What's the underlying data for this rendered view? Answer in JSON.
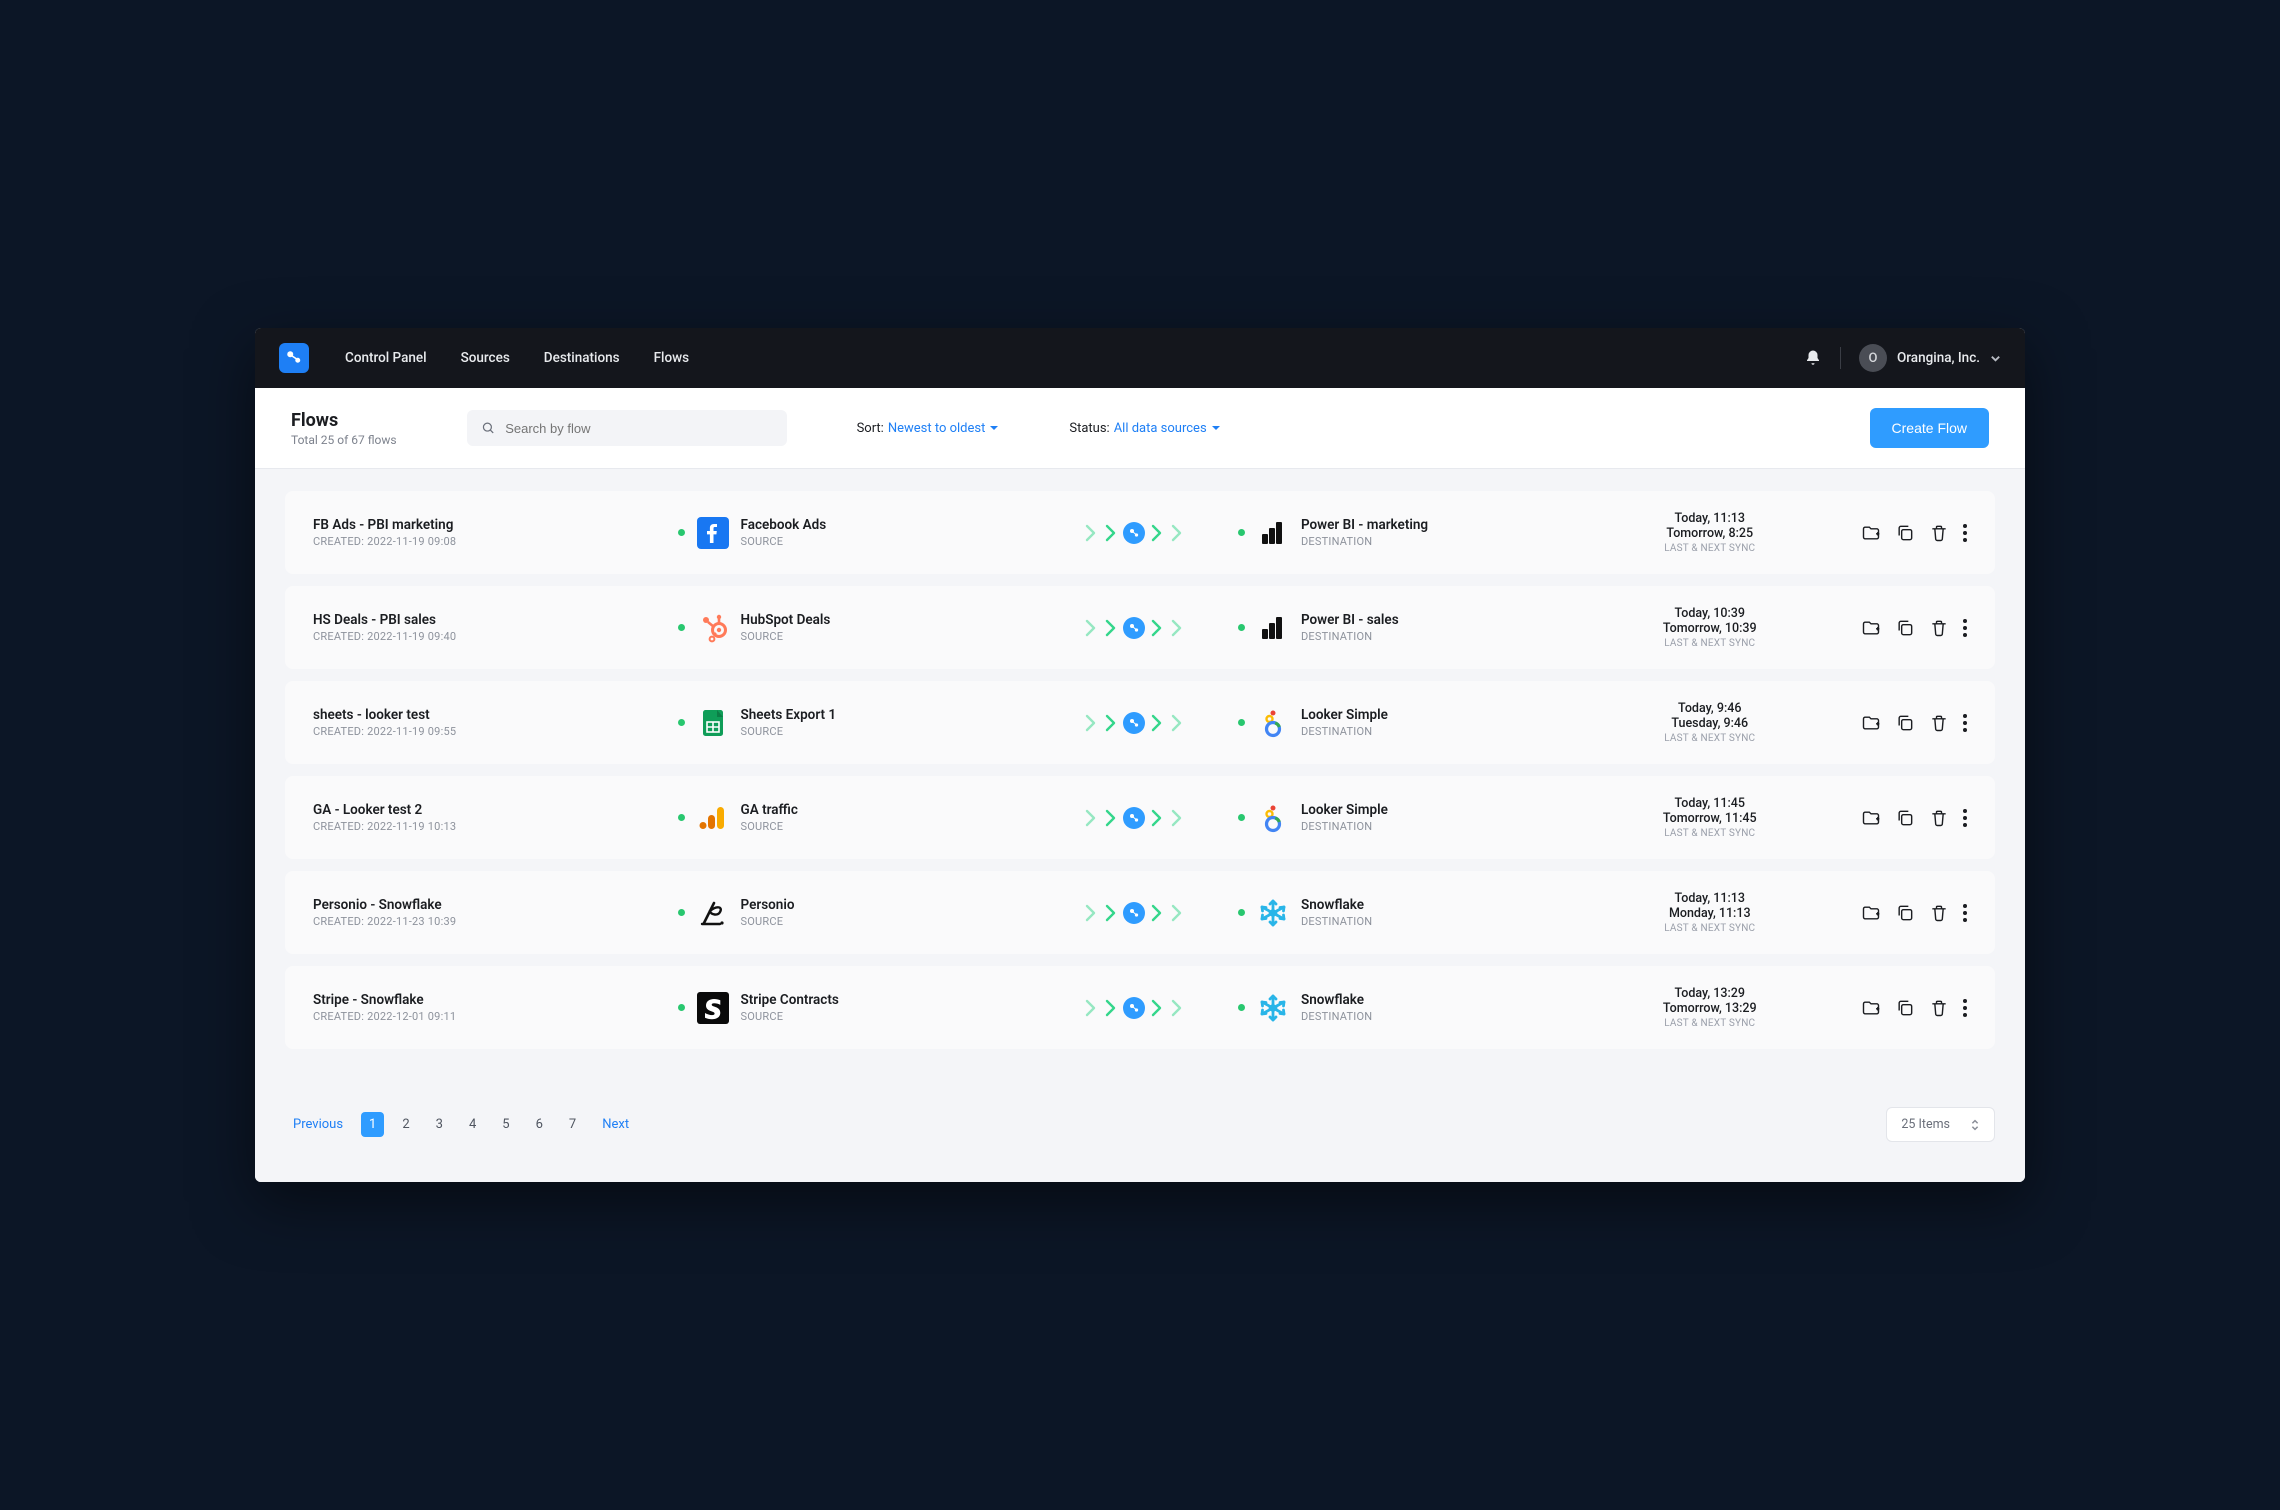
{
  "nav": {
    "items": [
      "Control Panel",
      "Sources",
      "Destinations",
      "Flows"
    ],
    "account_name": "Orangina, Inc.",
    "avatar_letter": "O"
  },
  "header": {
    "title": "Flows",
    "subtitle": "Total 25 of 67 flows",
    "search_placeholder": "Search by flow",
    "sort_label": "Sort:",
    "sort_value": "Newest to oldest",
    "status_label": "Status:",
    "status_value": "All data sources",
    "create_label": "Create Flow"
  },
  "common": {
    "source_label": "SOURCE",
    "destination_label": "DESTINATION",
    "sync_label": "LAST & NEXT SYNC"
  },
  "rows": [
    {
      "name": "FB Ads - PBI marketing",
      "created": "CREATED: 2022-11-19 09:08",
      "source": "Facebook Ads",
      "source_icon": "facebook",
      "destination": "Power BI - marketing",
      "dest_icon": "powerbi",
      "sync1": "Today, 11:13",
      "sync2": "Tomorrow, 8:25"
    },
    {
      "name": "HS Deals - PBI sales",
      "created": "CREATED: 2022-11-19 09:40",
      "source": "HubSpot Deals",
      "source_icon": "hubspot",
      "destination": "Power BI - sales",
      "dest_icon": "powerbi",
      "sync1": "Today, 10:39",
      "sync2": "Tomorrow, 10:39"
    },
    {
      "name": "sheets - looker test",
      "created": "CREATED: 2022-11-19 09:55",
      "source": "Sheets Export 1",
      "source_icon": "sheets",
      "destination": "Looker Simple",
      "dest_icon": "looker",
      "sync1": "Today, 9:46",
      "sync2": "Tuesday, 9:46"
    },
    {
      "name": "GA - Looker test 2",
      "created": "CREATED: 2022-11-19 10:13",
      "source": "GA traffic",
      "source_icon": "ga",
      "destination": "Looker Simple",
      "dest_icon": "looker",
      "sync1": "Today, 11:45",
      "sync2": "Tomorrow, 11:45"
    },
    {
      "name": "Personio - Snowflake",
      "created": "CREATED: 2022-11-23 10:39",
      "source": "Personio",
      "source_icon": "personio",
      "destination": "Snowflake",
      "dest_icon": "snowflake",
      "sync1": "Today, 11:13",
      "sync2": "Monday, 11:13"
    },
    {
      "name": "Stripe - Snowflake",
      "created": "CREATED: 2022-12-01 09:11",
      "source": "Stripe Contracts",
      "source_icon": "stripe",
      "destination": "Snowflake",
      "dest_icon": "snowflake",
      "sync1": "Today, 13:29",
      "sync2": "Tomorrow, 13:29"
    }
  ],
  "pager": {
    "prev": "Previous",
    "next": "Next",
    "pages": [
      "1",
      "2",
      "3",
      "4",
      "5",
      "6",
      "7"
    ],
    "active": "1",
    "per_page": "25 Items"
  }
}
